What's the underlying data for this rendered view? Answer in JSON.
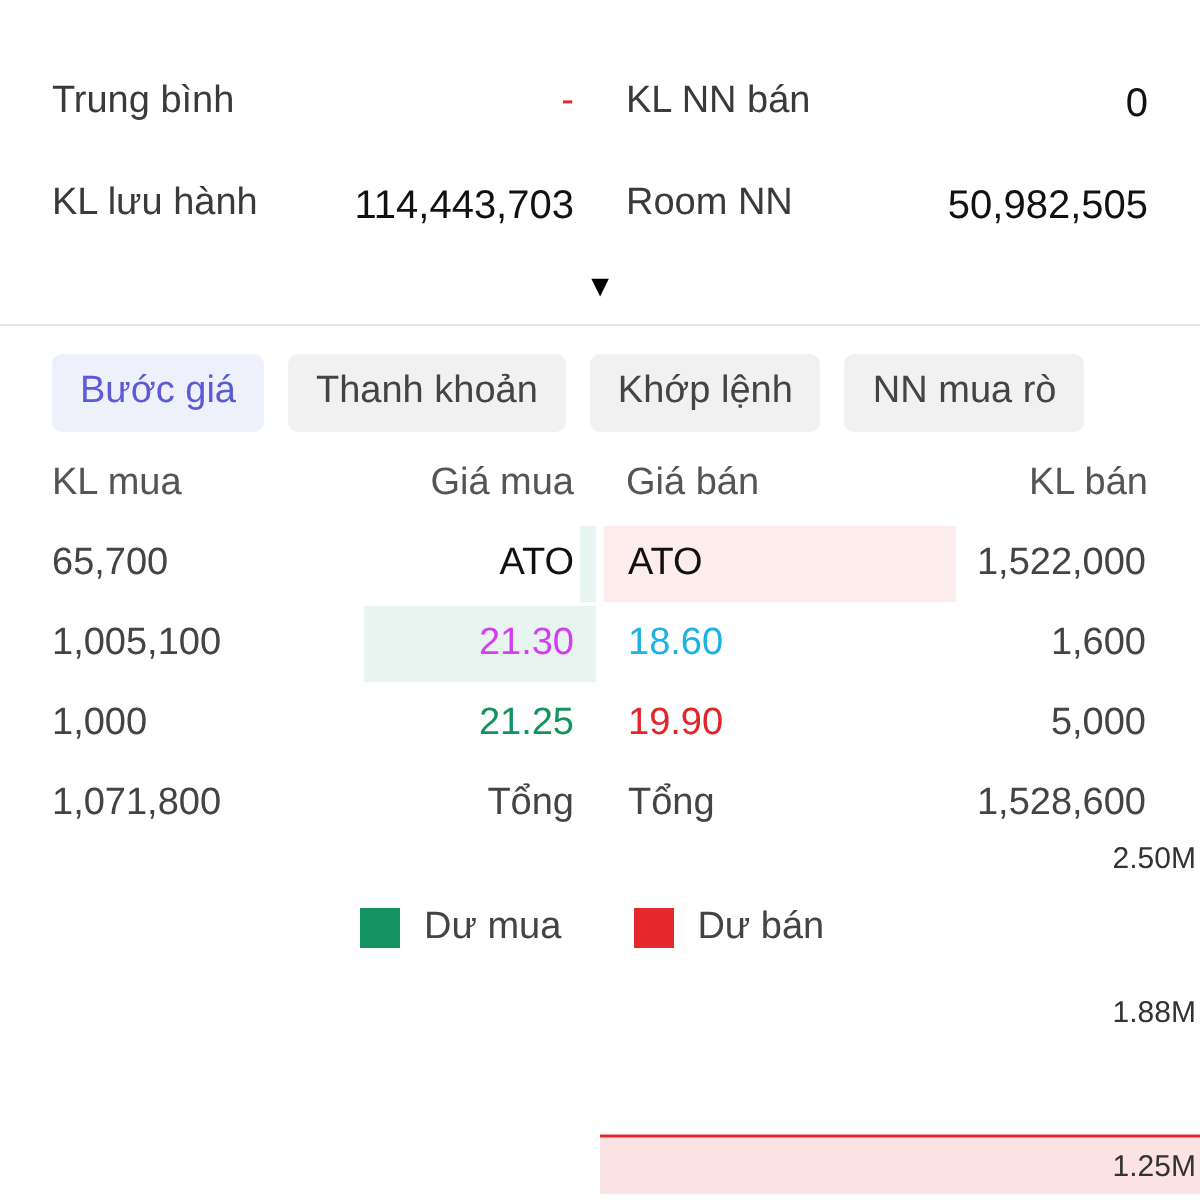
{
  "stats": [
    {
      "label": "Trung bình",
      "value": "-",
      "kind": "dash"
    },
    {
      "label": "KL NN bán",
      "value": "0",
      "kind": "number"
    },
    {
      "label": "KL lưu hành",
      "value": "114,443,703",
      "kind": "number"
    },
    {
      "label": "Room NN",
      "value": "50,982,505",
      "kind": "number"
    }
  ],
  "expand_caret": "▼",
  "tabs": [
    {
      "label": "Bước giá",
      "selected": true
    },
    {
      "label": "Thanh khoản",
      "selected": false
    },
    {
      "label": "Khớp lệnh",
      "selected": false
    },
    {
      "label": "NN mua rò",
      "selected": false
    }
  ],
  "order_book": {
    "columns": [
      "KL mua",
      "Giá mua",
      "Giá bán",
      "KL bán"
    ],
    "rows": [
      {
        "kind": "level",
        "buy": {
          "volume": "65,700",
          "price": "ATO",
          "color": "#111111"
        },
        "sell": {
          "price": "ATO",
          "color": "#111111",
          "volume": "1,522,000"
        }
      },
      {
        "kind": "level",
        "buy": {
          "volume": "1,005,100",
          "price": "21.30",
          "color": "#d23ef0"
        },
        "sell": {
          "price": "18.60",
          "color": "#1cb2e4",
          "volume": "1,600"
        }
      },
      {
        "kind": "level",
        "buy": {
          "volume": "1,000",
          "price": "21.25",
          "color": "#13935f"
        },
        "sell": {
          "price": "19.90",
          "color": "#e1252b",
          "volume": "5,000"
        }
      },
      {
        "kind": "total",
        "buy_volume": "1,071,800",
        "buy_price": "Tổng",
        "sell_price": "Tổng",
        "sell_volume": "1,528,600"
      }
    ]
  },
  "chart": {
    "y_axis_labels": [
      "2.50M",
      "1.88M",
      "1.25M"
    ],
    "legend": [
      {
        "name": "Dư mua",
        "color": "#13935f"
      },
      {
        "name": "Dư bán",
        "color": "#e5282e"
      }
    ]
  }
}
